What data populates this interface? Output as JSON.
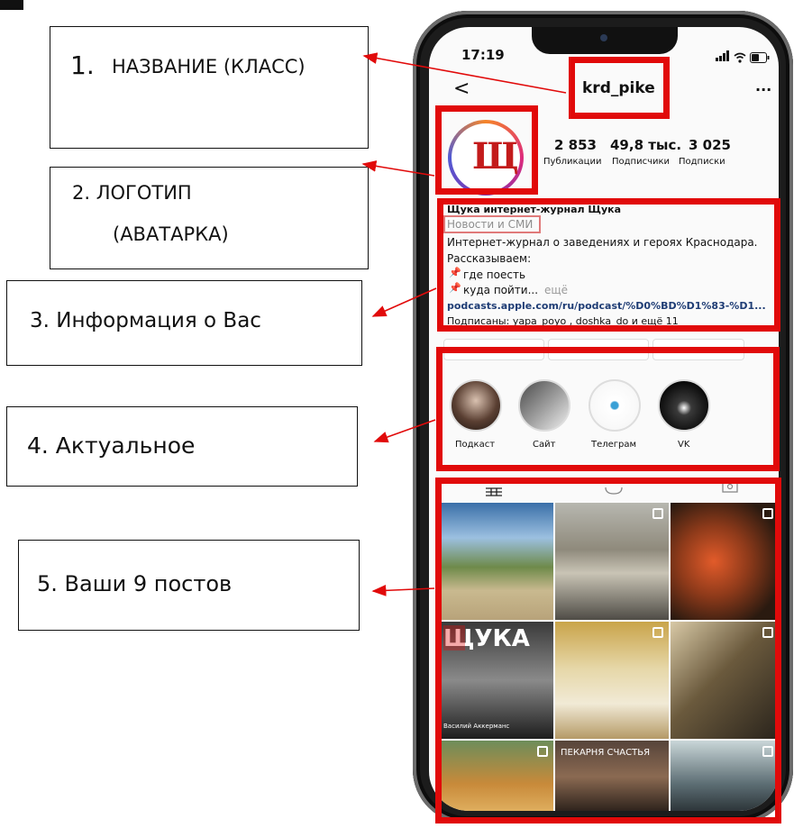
{
  "labels": {
    "l1_num": "1.",
    "l1_text": "НАЗВАНИЕ (КЛАСС)",
    "l2_line1": "2.  ЛОГОТИП",
    "l2_line2": "(АВАТАРКА)",
    "l3": "3. Информация о Вас",
    "l4": "4. Актуальное",
    "l5": "5. Ваши 9 постов"
  },
  "phone": {
    "status_time": "17:19",
    "username": "krd_pike",
    "back_glyph": "<",
    "more_glyph": "···",
    "avatar_letter": "Щ",
    "stats": [
      {
        "value": "2 853",
        "label": "Публикации"
      },
      {
        "value": "49,8 тыс.",
        "label": "Подписчики"
      },
      {
        "value": "3 025",
        "label": "Подписки"
      }
    ],
    "bio": {
      "name": "Щука интернет-журнал Щука",
      "category": "Новости и СМИ",
      "line1": "Интернет-журнал о заведениях и героях Краснодара.",
      "line2": "Рассказываем:",
      "line3": "где поесть",
      "line4": "куда пойти...",
      "more": "ещё",
      "link": "podcasts.apple.com/ru/podcast/%D0%BD%D1%83-%D1...",
      "followed": "Подписаны: yapa_poyo , doshka_do и ещё 11"
    },
    "highlights": [
      "Подкаст",
      "Сайт",
      "Телеграм",
      "VK"
    ],
    "grid_text": {
      "shchuka": "ЩУКА",
      "person": "Василий Аккерманс",
      "bakery": "ПЕКАРНЯ СЧАСТЬЯ"
    }
  },
  "colors": {
    "red": "#e10a0a",
    "link": "#1f3d75",
    "category": "#8e8e8e"
  },
  "icons": [
    "battery-icon",
    "wifi-icon",
    "signal-icon",
    "grid-icon",
    "reels-icon",
    "tagged-icon",
    "pin-icon"
  ]
}
